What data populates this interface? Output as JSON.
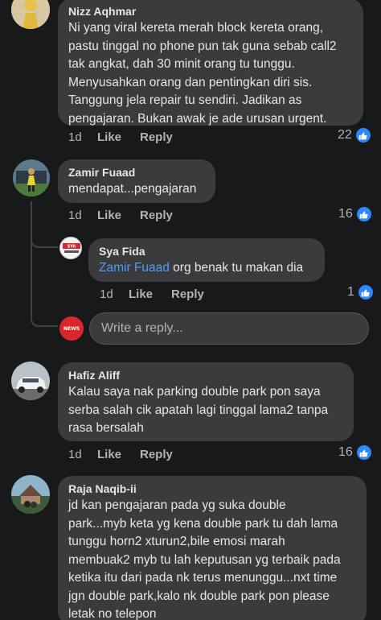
{
  "comments": [
    {
      "name": "Nizz Aqhmar",
      "lines": [
        "Ni yang viral kereta merah block kereta orang,",
        "pastu tinggal no phone pun tak guna sebab call2",
        "tak angkat, dah 30 minit orang tu tunggu.",
        "Menyusahkan orang dan pentingkan diri sis.",
        "Tanggung jela repair tu sendiri. Jadikan as",
        "pengajaran. Bukan awak je ade urusan urgent."
      ],
      "time": "1d",
      "like": "Like",
      "reply": "Reply",
      "reactions": "22"
    },
    {
      "name": "Zamir Fuaad",
      "lines": [
        "mendapat...pengajaran"
      ],
      "time": "1d",
      "like": "Like",
      "reply": "Reply",
      "reactions": "16"
    },
    {
      "name": "Sya Fida",
      "mention": "Zamir Fuaad",
      "text_after_mention": " org benak tu makan dia",
      "time": "1d",
      "like": "Like",
      "reply": "Reply",
      "reactions": "1"
    },
    {
      "name": "Hafiz Aliff",
      "lines": [
        "Kalau saya nak parking double park pon saya",
        "serba salah cik apatah lagi tinggal lama2 tanpa",
        "rasa bersalah"
      ],
      "time": "1d",
      "like": "Like",
      "reply": "Reply",
      "reactions": "16"
    },
    {
      "name": "Raja Naqib-ii",
      "lines": [
        "jd kan pengajaran pada yg suka double",
        "park...myb keta yg kena double park tu dah lama",
        "tunggu horn2 xturun2,bile emosi marah",
        "membuak2 myb tu lah keputusan yg terbaik pada",
        "ketika itu dari pada nk terus menunggu...nxt time",
        "jgn double park,kalo nk double park pon please",
        "letak no telepon"
      ]
    }
  ],
  "reply_box": {
    "placeholder": "Write a reply..."
  },
  "avatar_labels": {
    "reply_user": "NEWS",
    "sya_fida": "SYA"
  },
  "colors": {
    "background": "#18191a",
    "bubble": "#3a3b3c",
    "like_blue": "#2d88ff",
    "mention": "#4f9cf6",
    "meta_gray": "#b0b3b8"
  }
}
